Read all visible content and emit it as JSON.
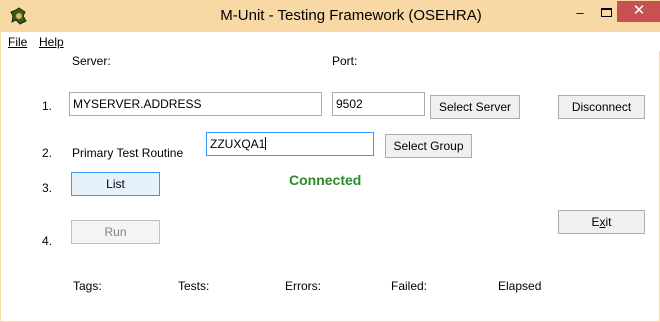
{
  "window": {
    "title": "M-Unit - Testing Framework (OSEHRA)",
    "minimize_glyph": "–",
    "close_glyph": "✕",
    "titlebar_color": "#f8d9a5",
    "close_color": "#c75050"
  },
  "menu": {
    "file": "File",
    "help": "Help"
  },
  "step1": {
    "number": "1.",
    "server_label": "Server:",
    "server_value": "MYSERVER.ADDRESS",
    "port_label": "Port:",
    "port_value": "9502",
    "select_server": "Select Server",
    "disconnect": "Disconnect"
  },
  "step2": {
    "number": "2.",
    "routine_label": "Primary Test Routine",
    "routine_value": "ZZUXQA1",
    "select_group": "Select Group"
  },
  "step3": {
    "number": "3.",
    "list": "List",
    "status": "Connected",
    "status_color": "#2b8b28"
  },
  "step4": {
    "number": "4.",
    "run": "Run",
    "exit_prefix": "E",
    "exit_underlined": "x",
    "exit_suffix": "it"
  },
  "stats": {
    "tags": "Tags:",
    "tests": "Tests:",
    "errors": "Errors:",
    "failed": "Failed:",
    "elapsed": "Elapsed"
  }
}
